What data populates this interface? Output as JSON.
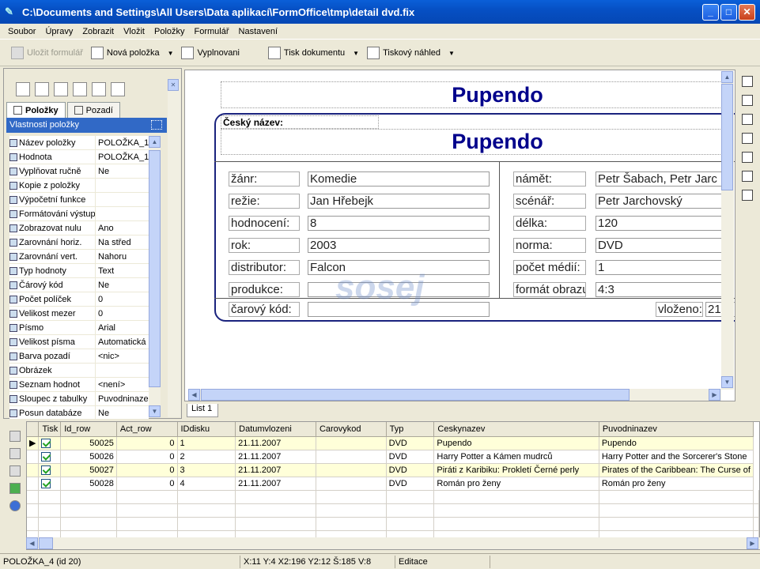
{
  "window": {
    "title": "C:\\Documents and Settings\\All Users\\Data aplikací\\FormOffice\\tmp\\detail dvd.fix"
  },
  "menu": [
    "Soubor",
    "Úpravy",
    "Zobrazit",
    "Vložit",
    "Položky",
    "Formulář",
    "Nastavení"
  ],
  "toolbar": {
    "save": "Uložit formulář",
    "new_item": "Nová položka",
    "fill": "Vyplnovani",
    "print": "Tisk dokumentu",
    "preview": "Tiskový náhled"
  },
  "left_panel": {
    "tabs": [
      "Položky",
      "Pozadí"
    ],
    "header": "Vlastnosti položky",
    "properties": [
      {
        "name": "Název položky",
        "value": "POLOŽKA_1"
      },
      {
        "name": "Hodnota",
        "value": "POLOŽKA_1"
      },
      {
        "name": "Vyplňovat ručně",
        "value": "Ne"
      },
      {
        "name": "Kopie z položky",
        "value": ""
      },
      {
        "name": "Výpočetní funkce",
        "value": ""
      },
      {
        "name": "Formátování výstup",
        "value": ""
      },
      {
        "name": "Zobrazovat nulu",
        "value": "Ano"
      },
      {
        "name": "Zarovnání horiz.",
        "value": "Na střed"
      },
      {
        "name": "Zarovnání vert.",
        "value": "Nahoru"
      },
      {
        "name": "Typ hodnoty",
        "value": "Text"
      },
      {
        "name": "Čárový kód",
        "value": "Ne"
      },
      {
        "name": "Počet políček",
        "value": "0"
      },
      {
        "name": "Velikost mezer",
        "value": "0"
      },
      {
        "name": "Písmo",
        "value": "Arial"
      },
      {
        "name": "Velikost písma",
        "value": "Automatická"
      },
      {
        "name": "Barva pozadí",
        "value": "<nic>"
      },
      {
        "name": "Obrázek",
        "value": ""
      },
      {
        "name": "Seznam hodnot",
        "value": "<není>"
      },
      {
        "name": "Sloupec z tabulky",
        "value": "Puvodninaze"
      },
      {
        "name": "Posun databáze",
        "value": "Ne"
      }
    ]
  },
  "form": {
    "title": "Pupendo",
    "cesky_label": "Český název:",
    "cesky_value": "Pupendo",
    "left_fields": [
      {
        "label": "žánr:",
        "value": "Komedie"
      },
      {
        "label": "režie:",
        "value": "Jan  Hřebejk"
      },
      {
        "label": "hodnocení:",
        "value": "8"
      },
      {
        "label": "rok:",
        "value": "2003"
      },
      {
        "label": "distributor:",
        "value": "Falcon"
      },
      {
        "label": "produkce:",
        "value": ""
      }
    ],
    "right_fields": [
      {
        "label": "námět:",
        "value": "Petr Šabach, Petr  Jarc"
      },
      {
        "label": "scénář:",
        "value": "Petr  Jarchovský"
      },
      {
        "label": "délka:",
        "value": "120"
      },
      {
        "label": "norma:",
        "value": "DVD"
      },
      {
        "label": "počet médií:",
        "value": "1"
      },
      {
        "label": "formát obrazu:",
        "value": "4:3"
      }
    ],
    "barcode_label": "čarový kód:",
    "inserted_label": "vloženo:",
    "inserted_value": "21",
    "watermark": "sosej"
  },
  "sheet_tab": "List 1",
  "grid": {
    "columns": [
      "Tisk",
      "Id_row",
      "Act_row",
      "IDdisku",
      "Datumvlozeni",
      "Carovykod",
      "Typ",
      "Ceskynazev",
      "Puvodninazev"
    ],
    "rows": [
      {
        "id": "50025",
        "act": "0",
        "disk": "1",
        "date": "21.11.2007",
        "code": "",
        "typ": "DVD",
        "cz": "Pupendo",
        "orig": "Pupendo"
      },
      {
        "id": "50026",
        "act": "0",
        "disk": "2",
        "date": "21.11.2007",
        "code": "",
        "typ": "DVD",
        "cz": "Harry Potter a Kámen mudrců",
        "orig": "Harry Potter and the Sorcerer's Stone"
      },
      {
        "id": "50027",
        "act": "0",
        "disk": "3",
        "date": "21.11.2007",
        "code": "",
        "typ": "DVD",
        "cz": "Piráti z Karibiku: Prokletí Černé perly",
        "orig": "Pirates of the Caribbean: The Curse of"
      },
      {
        "id": "50028",
        "act": "0",
        "disk": "4",
        "date": "21.11.2007",
        "code": "",
        "typ": "DVD",
        "cz": "Román pro ženy",
        "orig": "Román pro ženy"
      }
    ]
  },
  "status": {
    "item": "POLOŽKA_4 (id 20)",
    "coords": "X:11  Y:4  X2:196  Y2:12  Š:185  V:8",
    "mode": "Editace"
  }
}
